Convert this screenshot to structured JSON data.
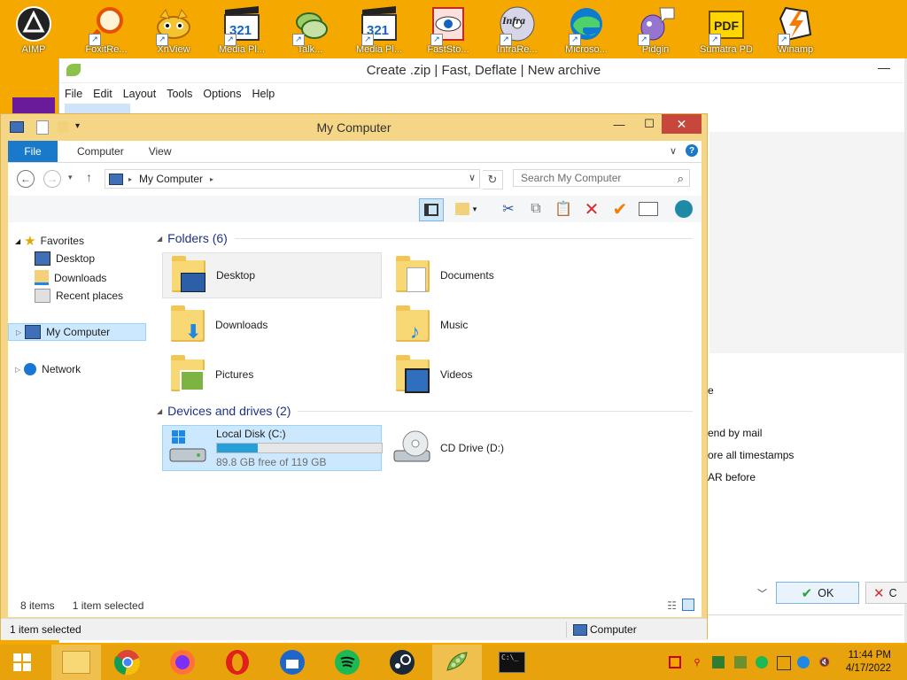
{
  "desktop": {
    "icons": [
      {
        "name": "aimp-icon",
        "label": "AIMP"
      },
      {
        "name": "foxit-icon",
        "label": "FoxitRe..."
      },
      {
        "name": "xnview-icon",
        "label": "XnView"
      },
      {
        "name": "mpc-icon",
        "label": "Media Pl..."
      },
      {
        "name": "talk-icon",
        "label": "Talk..."
      },
      {
        "name": "mpc2-icon",
        "label": "Media Pl..."
      },
      {
        "name": "faststone-icon",
        "label": "FastSto..."
      },
      {
        "name": "infrarecorder-icon",
        "label": "InfraRe..."
      },
      {
        "name": "edge-icon",
        "label": "Microso..."
      },
      {
        "name": "pidgin-icon",
        "label": "Pidgin"
      },
      {
        "name": "pdf-icon",
        "label": "Sumatra PDF"
      },
      {
        "name": "winamp-icon",
        "label": "Winamp"
      }
    ]
  },
  "peazip": {
    "title": "Create .zip | Fast, Deflate | New archive",
    "menu": [
      "File",
      "Edit",
      "Layout",
      "Tools",
      "Options",
      "Help"
    ],
    "options": [
      "e",
      "end by mail",
      "ore all timestamps",
      "AR before"
    ],
    "ok_label": "OK",
    "cancel_label": "C"
  },
  "explorer": {
    "title": "My Computer",
    "tabs": {
      "file": "File",
      "computer": "Computer",
      "view": "View"
    },
    "address": "My Computer",
    "search_placeholder": "Search My Computer",
    "nav": {
      "favorites": "Favorites",
      "desktop": "Desktop",
      "downloads": "Downloads",
      "recent": "Recent places",
      "my_computer": "My Computer",
      "network": "Network"
    },
    "folders_header": "Folders (6)",
    "folders": [
      "Desktop",
      "Documents",
      "Downloads",
      "Music",
      "Pictures",
      "Videos"
    ],
    "drives_header": "Devices and drives (2)",
    "drive_c": {
      "name": "Local Disk (C:)",
      "free": "89.8 GB free of 119 GB",
      "used_fraction": 0.245
    },
    "drive_d": {
      "name": "CD Drive (D:)"
    },
    "status_items": "8 items",
    "status_selected": "1 item selected",
    "statusbar_left": "1 item selected",
    "statusbar_right": "Computer"
  },
  "taskbar": {
    "time": "11:44 PM",
    "date": "4/17/2022"
  },
  "colors": {
    "desktop": "#F5A800",
    "taskbar": "#E8A20C",
    "accent": "#1979CA",
    "selection": "#CCE8FF"
  }
}
